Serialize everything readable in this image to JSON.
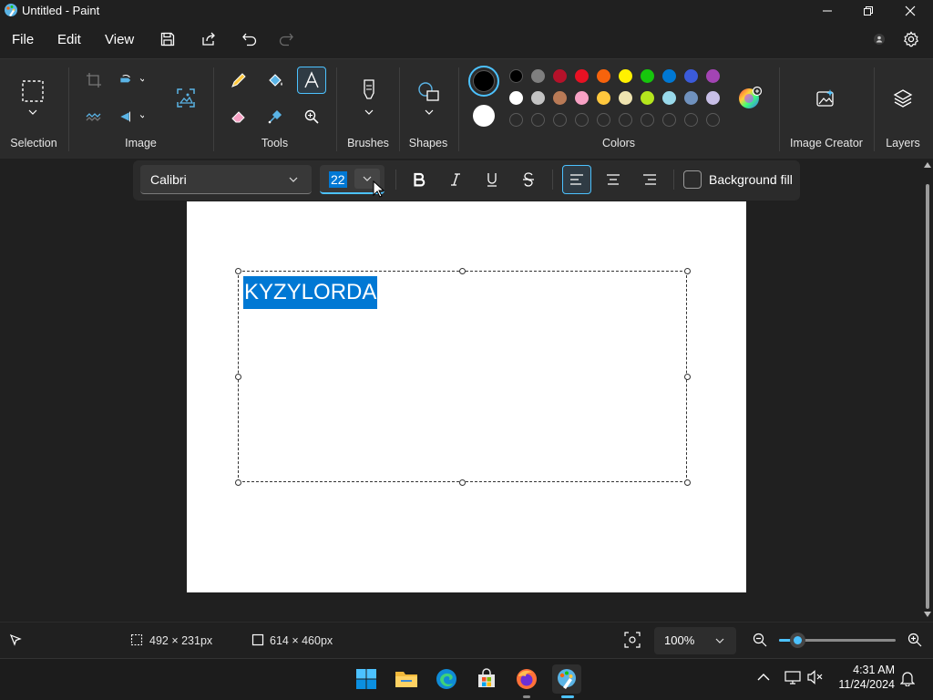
{
  "window": {
    "title": "Untitled - Paint"
  },
  "menu": {
    "file": "File",
    "edit": "Edit",
    "view": "View"
  },
  "ribbon": {
    "groups": {
      "selection": "Selection",
      "image": "Image",
      "tools": "Tools",
      "brushes": "Brushes",
      "shapes": "Shapes",
      "colors": "Colors",
      "image_creator": "Image Creator",
      "layers": "Layers"
    },
    "palette_row1": [
      "#000000",
      "#7f7f7f",
      "#b5122a",
      "#e81123",
      "#f7630c",
      "#fff100",
      "#16c60c",
      "#0078d4",
      "#3b5bdb",
      "#a344b4"
    ],
    "palette_row2": [
      "#ffffff",
      "#c3c3c3",
      "#b97a56",
      "#f7a1c4",
      "#ffc83d",
      "#efe4b0",
      "#b5e61d",
      "#99d9ea",
      "#7092be",
      "#c8bfe7"
    ],
    "primary_color": "#000000",
    "secondary_color": "#ffffff"
  },
  "text_toolbar": {
    "font": "Calibri",
    "size": "22",
    "background_fill_label": "Background fill",
    "background_fill_checked": false
  },
  "canvas": {
    "text": "KYZYLORDA"
  },
  "status": {
    "selection_size": "492 × 231px",
    "canvas_size": "614 × 460px",
    "zoom": "100%"
  },
  "taskbar": {
    "time": "4:31 AM",
    "date": "11/24/2024"
  },
  "colors": {
    "accent": "#4cc2ff",
    "selection": "#0078d4"
  }
}
